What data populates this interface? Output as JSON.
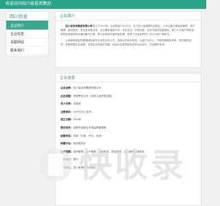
{
  "header": {
    "site_title": "欢迎访问四川省投资集团"
  },
  "sidebar": {
    "title": "四川信息",
    "items": [
      {
        "label": "企业简介"
      },
      {
        "label": "企业信息"
      },
      {
        "label": "关联网站"
      },
      {
        "label": "联系我们"
      }
    ]
  },
  "intro": {
    "heading": "企业简介",
    "paragraph1_company": "四川省投资集团有限公司",
    "paragraph1": "成立于2003年，注册资金1000万元，位于四川省成都市武侯区。公司主要从事投资管理、资产管理、股权投资、项目投资等业务。企业秉承诚信为本、专业务实、开拓创新、合作共赢的经营理念，致力于为客户提供优质的投资服务和全面的解决方案，助力区域经济高质量发展，获得了社会各界的广泛认可和一致好评。",
    "paragraph2": "公司拥有稳定的管理团队和专业化的业务人员，坚持以市场为导向，以客户为中心，不断完善服务体系，提升服务品质，积极拓展业务领域，实现企业的稳步发展。欢迎社会各界朋友前来洽谈合作，共创美好未来。"
  },
  "info": {
    "heading": "企业信息",
    "rows": [
      {
        "key": "企业全称：",
        "value": "四川省投资集团有限公司"
      },
      {
        "key": "企业类型：",
        "value": "有限责任公司（自然人投资或控股）"
      },
      {
        "key": "法人代表：",
        "value": "张某某"
      },
      {
        "key": "注册资本：",
        "value": "1000万元人民币"
      },
      {
        "key": "成立日期：",
        "value": "2003年"
      },
      {
        "key": "登记机关：",
        "value": "成都市武侯区市场监督管理局"
      },
      {
        "key": "经营状态：",
        "value": "存续（在营、开业、在册）"
      },
      {
        "key": "所属行业：",
        "value": "商务服务业"
      },
      {
        "key": "经营范围：",
        "value": "投资管理、资产管理、股权投资、项目投资；企业管理咨询服务。"
      },
      {
        "key": "联系电话：",
        "value": "暂无"
      },
      {
        "key": "企业地址：",
        "value": "四川省成都市武侯区"
      }
    ]
  },
  "watermark": {
    "text": "快收录"
  }
}
